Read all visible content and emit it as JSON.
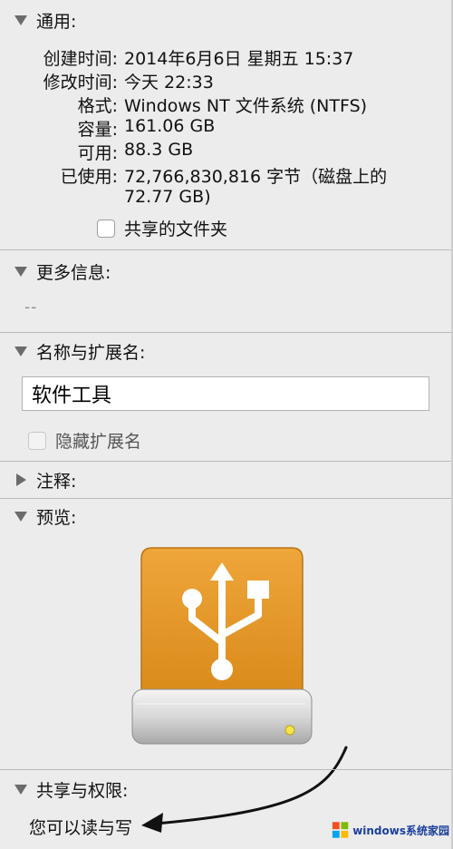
{
  "sections": {
    "general": {
      "label": "通用:"
    },
    "more_info": {
      "label": "更多信息:",
      "value": "--"
    },
    "name_ext": {
      "label": "名称与扩展名:"
    },
    "comments": {
      "label": "注释:"
    },
    "preview": {
      "label": "预览:"
    },
    "sharing": {
      "label": "共享与权限:"
    }
  },
  "general": {
    "rows": [
      {
        "label": "创建时间:",
        "value": "2014年6月6日 星期五 15:37"
      },
      {
        "label": "修改时间:",
        "value": "今天 22:33"
      },
      {
        "label": "格式:",
        "value": "Windows NT 文件系统 (NTFS)"
      },
      {
        "label": "容量:",
        "value": "161.06 GB"
      },
      {
        "label": "可用:",
        "value": "88.3 GB"
      },
      {
        "label": "已使用:",
        "value": "72,766,830,816 字节（磁盘上的"
      }
    ],
    "used_cont": "72.77 GB)",
    "shared_folder_label": "共享的文件夹"
  },
  "name_ext": {
    "name_value": "软件工具",
    "hide_ext_label": "隐藏扩展名"
  },
  "preview": {
    "icon": "usb-drive-icon",
    "drive_color": "#e69b2a"
  },
  "sharing": {
    "permission_text": "您可以读与写"
  },
  "watermark": {
    "text": "windows系统家园"
  }
}
